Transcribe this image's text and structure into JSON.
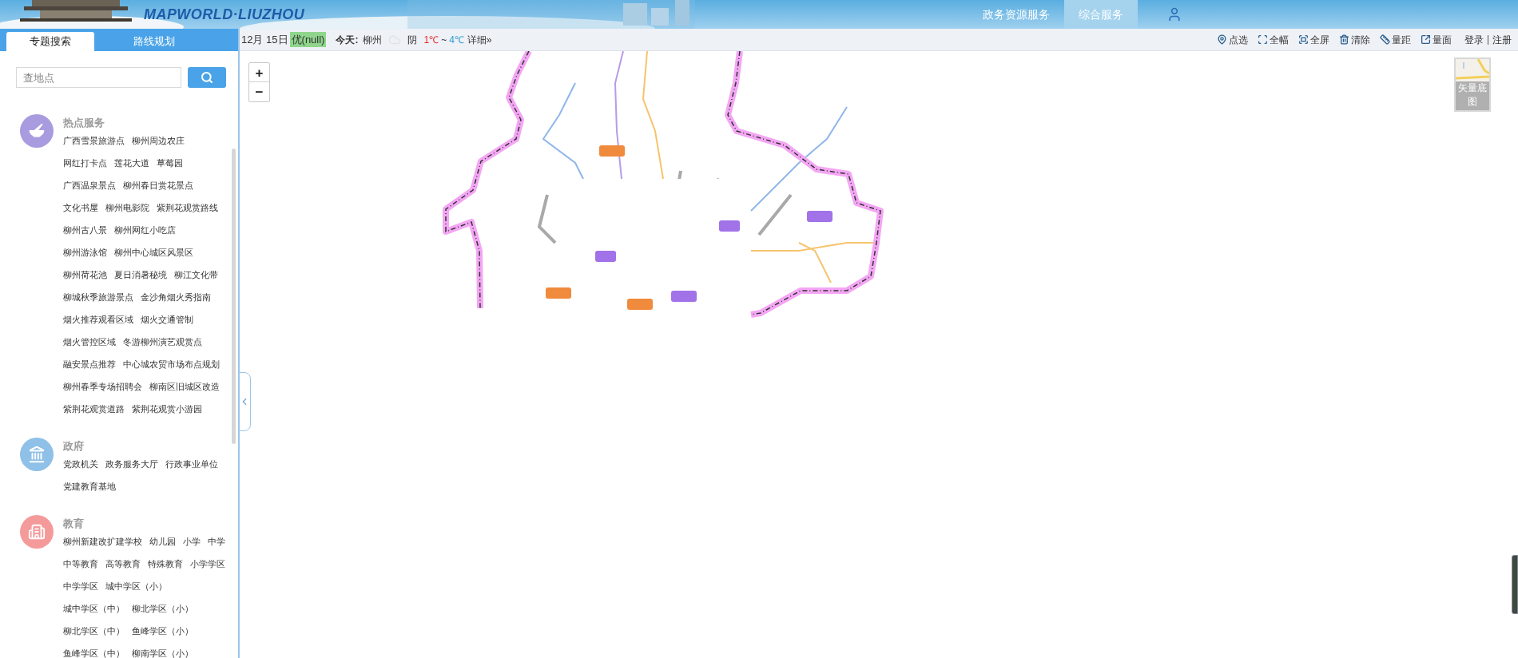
{
  "header": {
    "logo": "MAPWORLD·LIUZHOU",
    "nav": [
      {
        "label": "政务资源服务",
        "selected": false
      },
      {
        "label": "综合服务",
        "selected": true
      }
    ]
  },
  "sidebar": {
    "tabs": [
      {
        "label": "专题搜索",
        "selected": true
      },
      {
        "label": "路线规划",
        "selected": false
      }
    ],
    "search": {
      "placeholder": "查地点"
    },
    "categories": [
      {
        "title": "热点服务",
        "kind": "bowl",
        "color": "#a99be0",
        "lines": [
          {
            "links": [
              "广西雪景旅游点",
              "柳州周边农庄"
            ]
          },
          {
            "links": [
              "网红打卡点",
              "莲花大道",
              "草莓园"
            ]
          },
          {
            "links": [
              "广西温泉景点",
              "柳州春日赏花景点"
            ]
          },
          {
            "links": [
              "文化书屋",
              "柳州电影院",
              "紫荆花观赏路线"
            ]
          },
          {
            "links": [
              "柳州古八景",
              "柳州网红小吃店"
            ]
          },
          {
            "links": [
              "柳州游泳馆",
              "柳州中心城区风景区"
            ]
          },
          {
            "links": [
              "柳州荷花池",
              "夏日消暑秘境",
              "柳江文化带"
            ]
          },
          {
            "links": [
              "柳城秋季旅游景点",
              "金沙角烟火秀指南"
            ]
          },
          {
            "links": [
              "烟火推荐观看区域",
              "烟火交通管制"
            ]
          },
          {
            "links": [
              "烟火管控区域",
              "冬游柳州演艺观赏点"
            ]
          },
          {
            "links": [
              "融安景点推荐",
              "中心城农贸市场布点规划"
            ]
          },
          {
            "links": [
              "柳州春季专场招聘会",
              "柳南区旧城区改造"
            ]
          },
          {
            "links": [
              "紫荆花观赏道路",
              "紫荆花观赏小游园"
            ]
          }
        ]
      },
      {
        "title": "政府",
        "kind": "government",
        "color": "#8ec0e8",
        "lines": [
          {
            "links": [
              "党政机关",
              "政务服务大厅",
              "行政事业单位"
            ]
          },
          {
            "links": [
              "党建教育基地"
            ]
          }
        ]
      },
      {
        "title": "教育",
        "kind": "education",
        "color": "#f59a9a",
        "lines": [
          {
            "links": [
              "柳州新建改扩建学校",
              "幼儿园",
              "小学",
              "中学"
            ]
          },
          {
            "links": [
              "中等教育",
              "高等教育",
              "特殊教育",
              "小学学区"
            ]
          },
          {
            "links": [
              "中学学区",
              "城中学区（小）"
            ]
          },
          {
            "links": [
              "城中学区（中）",
              "柳北学区（小）"
            ]
          },
          {
            "links": [
              "柳北学区（中）",
              "鱼峰学区（小）"
            ]
          },
          {
            "links": [
              "鱼峰学区（中）",
              "柳南学区（小）"
            ]
          }
        ]
      }
    ]
  },
  "toolbar": {
    "date": "12月 15日",
    "aqi": "优(null)",
    "today_label": "今天:",
    "city": "柳州",
    "weather": "阴",
    "temp_low": "1℃",
    "separator": "~",
    "temp_high": "4℃",
    "details_link": "详细»",
    "tools": [
      {
        "kind": "pin",
        "label": "点选"
      },
      {
        "kind": "extent",
        "label": "全幅"
      },
      {
        "kind": "fullscreen",
        "label": "全屏"
      },
      {
        "kind": "clear",
        "label": "清除"
      },
      {
        "kind": "distance",
        "label": "量距"
      },
      {
        "kind": "area",
        "label": "量面"
      }
    ],
    "account": [
      "登录",
      "注册"
    ]
  },
  "map": {
    "zoom_in": "+",
    "zoom_out": "−",
    "basemap_label": "矢量底图"
  }
}
